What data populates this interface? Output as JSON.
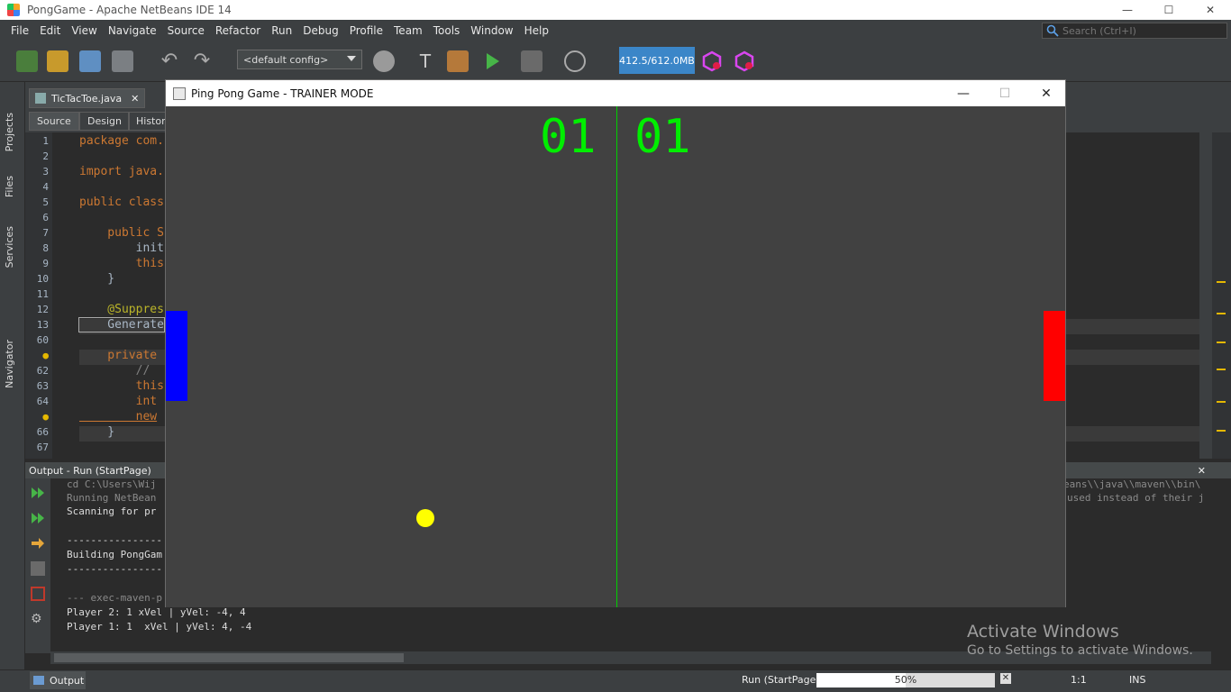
{
  "ide": {
    "title": "PongGame - Apache NetBeans IDE 14",
    "window_controls": [
      "—",
      "☐",
      "✕"
    ],
    "menu": [
      "File",
      "Edit",
      "View",
      "Navigate",
      "Source",
      "Refactor",
      "Run",
      "Debug",
      "Profile",
      "Team",
      "Tools",
      "Window",
      "Help"
    ],
    "search_placeholder": "Search (Ctrl+I)",
    "config": "<default config>",
    "memory": "412.5/612.0MB",
    "side_tabs": [
      "Projects",
      "Files",
      "Services",
      "Navigator"
    ],
    "editor_tab": "TicTacToe.java",
    "subtabs": [
      "Source",
      "Design",
      "History"
    ],
    "line_numbers": [
      "1",
      "2",
      "3",
      "4",
      "5",
      "6",
      "7",
      "8",
      "9",
      "10",
      "11",
      "12",
      "13",
      "60",
      "",
      "62",
      "63",
      "64",
      "",
      "66",
      "67"
    ],
    "code_lines": [
      "package com.",
      "",
      "import java.",
      "",
      "public class",
      "",
      "    public S",
      "        init",
      "        this",
      "    }",
      "",
      "    @Suppres",
      "    Generate",
      "",
      "    private",
      "        //",
      "        this",
      "        int",
      "        new",
      "    }",
      ""
    ],
    "output_title": "Output - Run (StartPage)",
    "output_lines": [
      "cd C:\\Users\\Wij",
      "Running NetBean",
      "Scanning for pr",
      "",
      "----------------",
      "Building PongGam",
      "----------------",
      "",
      "--- exec-maven-p",
      "Player 2: 1 xVel | yVel: -4, 4",
      "Player 1: 1  xVel | yVel: 4, -4"
    ],
    "output_right_lines": [
      "eans\\\\java\\\\maven\\\\bin\\",
      "used instead of their j"
    ],
    "status": {
      "output_tab": "Output",
      "run_label": "Run (StartPage)",
      "progress_text": "50%",
      "progress": 0.5,
      "position": "1:1",
      "mode": "INS"
    },
    "watermark": {
      "line1": "Activate Windows",
      "line2": "Go to Settings to activate Windows."
    }
  },
  "game": {
    "title": "Ping Pong Game - TRAINER MODE",
    "score_left": "01",
    "score_right": "01",
    "colors": {
      "background": "#414141",
      "score": "#00ee00",
      "center_line": "#00d000",
      "paddle_left": "#0000ff",
      "paddle_right": "#ff0000",
      "ball": "#ffff00"
    }
  }
}
